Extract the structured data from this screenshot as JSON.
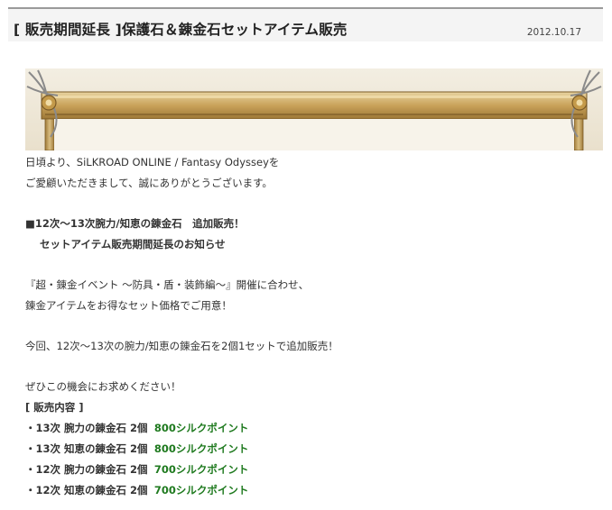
{
  "header": {
    "title": "[ 販売期間延長 ]保護石＆錬金石セットアイテム販売",
    "date": "2012.10.17"
  },
  "body": {
    "greeting1": "日頃より、SiLKROAD ONLINE / Fantasy Odysseyを",
    "greeting2": "ご愛顧いただきまして、誠にありがとうございます。",
    "headline1": "■12次～13次腕力/知恵の錬金石　追加販売！",
    "headline2": "セットアイテム販売期間延長のお知らせ",
    "event1": "『超・錬金イベント ～防具・盾・装飾編～』開催に合わせ、",
    "event2": "錬金アイテムをお得なセット価格でご用意！",
    "notice": "今回、12次～13次の腕力/知恵の錬金石を2個1セットで追加販売！",
    "closing": "ぜひこの機会にお求めください！",
    "section_label": "[ 販売内容 ]",
    "items": [
      {
        "name": "・13次 腕力の錬金石 2個",
        "price": "800シルクポイント"
      },
      {
        "name": "・13次 知恵の錬金石 2個",
        "price": "800シルクポイント"
      },
      {
        "name": "・12次 腕力の錬金石 2個",
        "price": "700シルクポイント"
      },
      {
        "name": "・12次 知恵の錬金石 2個",
        "price": "700シルクポイント"
      }
    ]
  },
  "colors": {
    "price": "#1f7a1f",
    "frame_gold": "#b8934a"
  }
}
